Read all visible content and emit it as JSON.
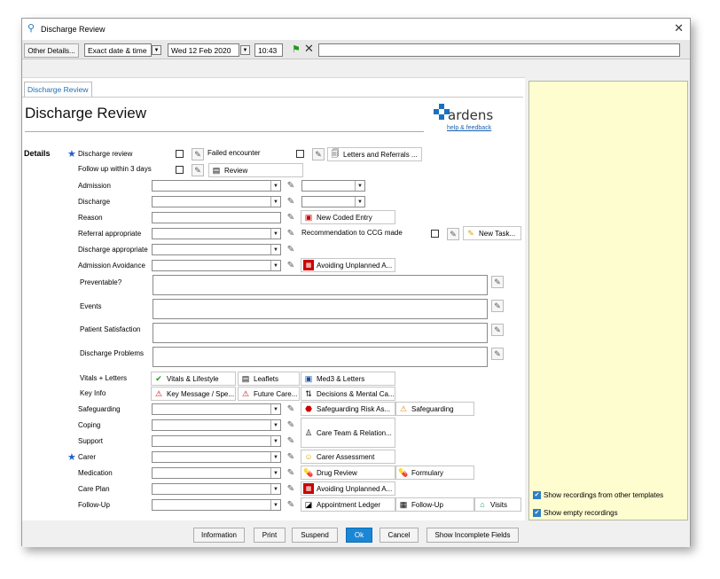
{
  "window": {
    "title": "Discharge Review"
  },
  "toolbar": {
    "other_details": "Other Details...",
    "date_mode": "Exact date & time",
    "date": "Wed 12 Feb 2020",
    "time": "10:43"
  },
  "tab": {
    "label": "Discharge Review"
  },
  "page": {
    "heading": "Discharge Review"
  },
  "logo": {
    "name": "ardens",
    "link": "help & feedback"
  },
  "details_label": "Details",
  "rows": {
    "discharge_review": "Discharge review",
    "failed_encounter": "Failed encounter",
    "letters_referrals": "Letters and Referrals ...",
    "follow_up_3": "Follow up within 3 days",
    "review": "Review",
    "admission": "Admission",
    "discharge": "Discharge",
    "reason": "Reason",
    "new_coded_entry": "New Coded Entry",
    "referral_appropriate": "Referral appropriate",
    "recommendation_ccg": "Recommendation to CCG made",
    "new_task": "New Task...",
    "discharge_appropriate": "Discharge appropriate",
    "admission_avoidance": "Admission Avoidance",
    "avoiding_unplanned_1": "Avoiding Unplanned A...",
    "preventable": "Preventable?",
    "events": "Events",
    "patient_satisfaction": "Patient Satisfaction",
    "discharge_problems": "Discharge Problems",
    "vitals_letters": "Vitals + Letters",
    "vitals_lifestyle": "Vitals & Lifestyle",
    "leaflets": "Leaflets",
    "med3_letters": "Med3 & Letters",
    "key_info": "Key Info",
    "key_message": "Key Message / Spe...",
    "future_care": "Future Care...",
    "decisions_mental": "Decisions & Mental Ca...",
    "safeguarding": "Safeguarding",
    "safeguarding_risk": "Safeguarding Risk As...",
    "safeguarding_btn": "Safeguarding",
    "coping": "Coping",
    "support": "Support",
    "care_team": "Care Team & Relation...",
    "carer": "Carer",
    "carer_assessment": "Carer Assessment",
    "medication": "Medication",
    "drug_review": "Drug Review",
    "formulary": "Formulary",
    "care_plan": "Care Plan",
    "avoiding_unplanned_2": "Avoiding Unplanned A...",
    "follow_up": "Follow-Up",
    "appointment_ledger": "Appointment Ledger",
    "follow_up_btn": "Follow-Up",
    "visits": "Visits"
  },
  "side": {
    "show_other_templates": "Show recordings from other templates",
    "show_empty": "Show empty recordings"
  },
  "buttons": {
    "information": "Information",
    "print": "Print",
    "suspend": "Suspend",
    "ok": "Ok",
    "cancel": "Cancel",
    "show_incomplete": "Show Incomplete Fields"
  },
  "colors": {
    "accent": "#1a86d6",
    "side_panel": "#fdfdd0",
    "star": "#1e5fd0"
  }
}
